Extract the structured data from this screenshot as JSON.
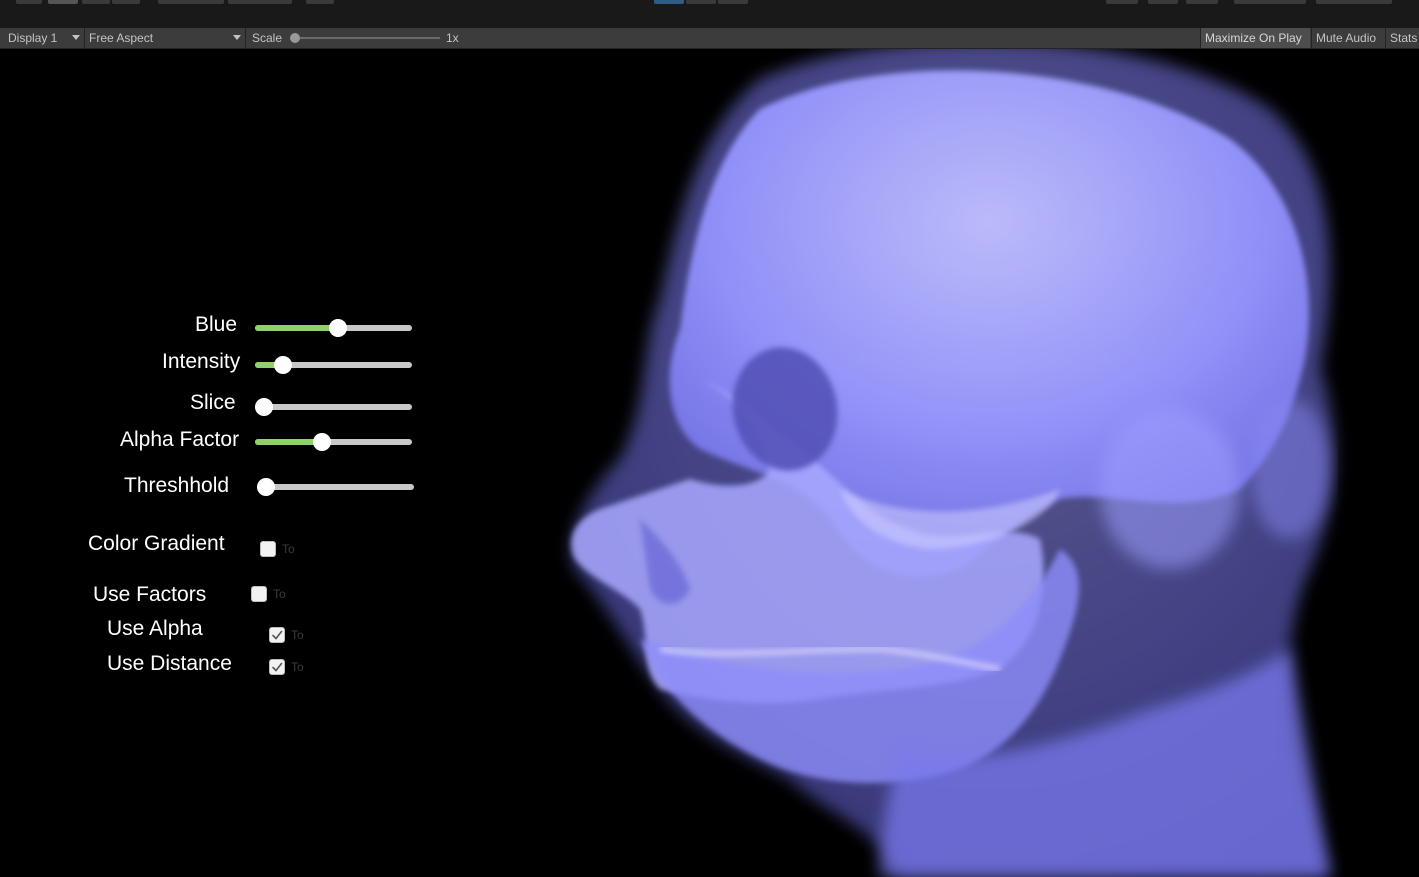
{
  "toolbar": {
    "display": "Display 1",
    "aspect": "Free Aspect",
    "scale_label": "Scale",
    "scale_value": "1x",
    "scale_level": 0,
    "maximize_on_play": "Maximize On Play",
    "mute_audio": "Mute Audio",
    "stats": "Stats"
  },
  "sliders": [
    {
      "label": "Blue",
      "value": 0.47,
      "filled": true
    },
    {
      "label": "Intensity",
      "value": 0.12,
      "filled": true
    },
    {
      "label": "Slice",
      "value": 0.0,
      "filled": false
    },
    {
      "label": "Alpha Factor",
      "value": 0.37,
      "filled": true
    },
    {
      "label": "Threshhold",
      "value": 0.0,
      "filled": false
    }
  ],
  "toggles": [
    {
      "label": "Color Gradient",
      "checked": false,
      "text": "To"
    },
    {
      "label": "Use Factors",
      "checked": false,
      "text": "To"
    },
    {
      "label": "Use Alpha",
      "checked": true,
      "text": "To"
    },
    {
      "label": "Use Distance",
      "checked": true,
      "text": "To"
    }
  ],
  "colors": {
    "render": "#7d7cf0",
    "slider_fill": "#8fd16b",
    "background": "#000000"
  }
}
